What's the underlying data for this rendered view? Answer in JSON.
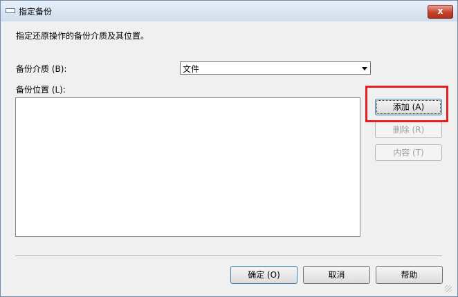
{
  "window": {
    "title": "指定备份",
    "close_label": "x",
    "close_color": "#c5432c"
  },
  "dialog": {
    "instruction": "指定还原操作的备份介质及其位置。",
    "media_label": "备份介质 (B):",
    "media_value": "文件",
    "location_label": "备份位置 (L):",
    "locations": []
  },
  "side_buttons": {
    "add": "添加 (A)",
    "remove": "删除 (R)",
    "contents": "内容 (T)"
  },
  "footer": {
    "ok": "确定 (O)",
    "cancel": "取消",
    "help": "帮助"
  },
  "highlight_color": "#e81d1d"
}
